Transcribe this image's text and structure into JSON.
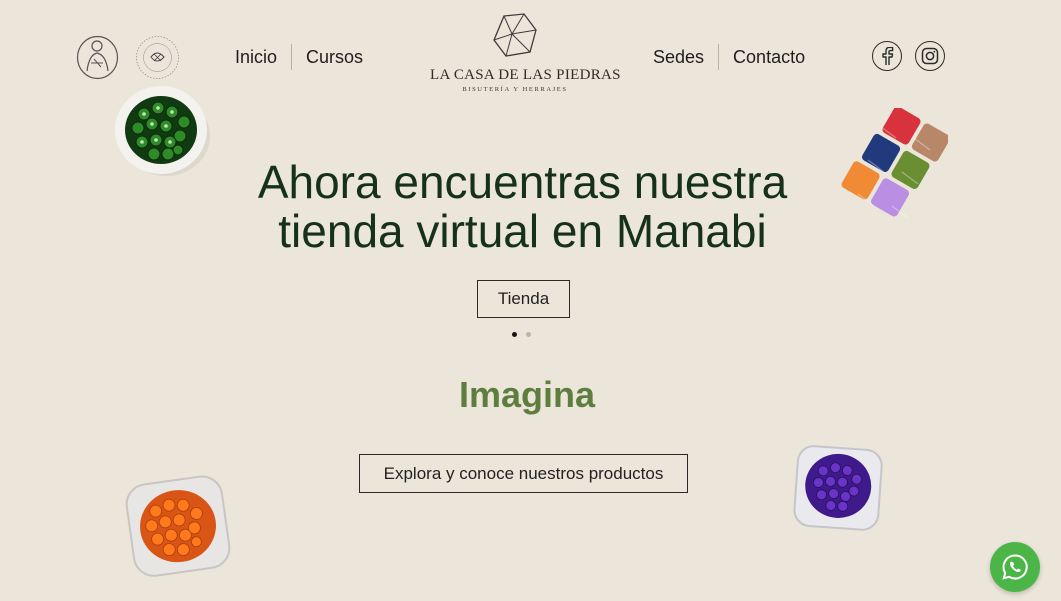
{
  "nav": {
    "left": [
      "Inicio",
      "Cursos"
    ],
    "right": [
      "Sedes",
      "Contacto"
    ]
  },
  "brand": {
    "name": "LA CASA DE LAS PIEDRAS",
    "tagline": "BISUTERÍA Y HERRAJES"
  },
  "partner_logo": {
    "circular_text": "MANABI · TALLER DE MANUALIDADES"
  },
  "social": {
    "facebook": "facebook-icon",
    "instagram": "instagram-icon"
  },
  "hero": {
    "title_line1": "Ahora encuentras nuestra",
    "title_line2": "tienda virtual en Manabi",
    "button": "Tienda",
    "slides": 2,
    "active_slide": 1
  },
  "section": {
    "heading": "Imagina",
    "button": "Explora y conoce nuestros productos"
  },
  "whatsapp": {
    "icon": "whatsapp-icon"
  },
  "colors": {
    "background": "#ece5d9",
    "heading_dark_green": "#15301b",
    "imagina_green": "#5e7e3f",
    "whatsapp_green": "#4cb548"
  }
}
